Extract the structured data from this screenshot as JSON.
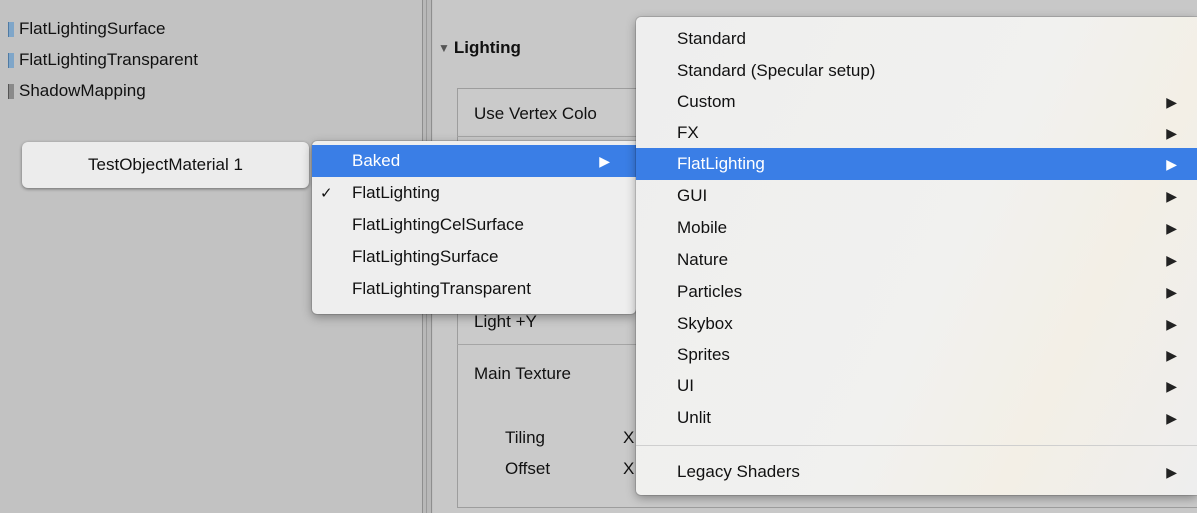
{
  "project_list": {
    "items": [
      {
        "label": "FlatLightingSurface",
        "icon": "shader-file-icon"
      },
      {
        "label": "FlatLightingTransparent",
        "icon": "shader-file-icon"
      },
      {
        "label": "ShadowMapping",
        "icon": "folder-icon"
      }
    ]
  },
  "inspector": {
    "section_title": "Lighting",
    "use_vertex_colors": "Use Vertex Colo",
    "light_y": "Light +Y",
    "main_texture": "Main Texture",
    "tiling": "Tiling",
    "offset": "Offset",
    "tiling_x": "X",
    "offset_x": "X"
  },
  "material_button": {
    "label": "TestObjectMaterial 1"
  },
  "shader_submenu": {
    "items": [
      {
        "label": "Baked",
        "has_submenu": true,
        "highlighted": true
      },
      {
        "label": "FlatLighting",
        "checked": true
      },
      {
        "label": "FlatLightingCelSurface"
      },
      {
        "label": "FlatLightingSurface"
      },
      {
        "label": "FlatLightingTransparent"
      }
    ]
  },
  "shader_menu": {
    "items": [
      {
        "label": "Standard"
      },
      {
        "label": "Standard (Specular setup)"
      },
      {
        "label": "Custom",
        "has_submenu": true
      },
      {
        "label": "FX",
        "has_submenu": true
      },
      {
        "label": "FlatLighting",
        "has_submenu": true,
        "highlighted": true
      },
      {
        "label": "GUI",
        "has_submenu": true
      },
      {
        "label": "Mobile",
        "has_submenu": true
      },
      {
        "label": "Nature",
        "has_submenu": true
      },
      {
        "label": "Particles",
        "has_submenu": true
      },
      {
        "label": "Skybox",
        "has_submenu": true
      },
      {
        "label": "Sprites",
        "has_submenu": true
      },
      {
        "label": "UI",
        "has_submenu": true
      },
      {
        "label": "Unlit",
        "has_submenu": true
      },
      {
        "label": "Legacy Shaders",
        "has_submenu": true
      }
    ]
  },
  "symbols": {
    "arrow": "▶",
    "check": "✓",
    "collapse": "▼"
  },
  "colors": {
    "highlight": "#3a7ee6"
  }
}
